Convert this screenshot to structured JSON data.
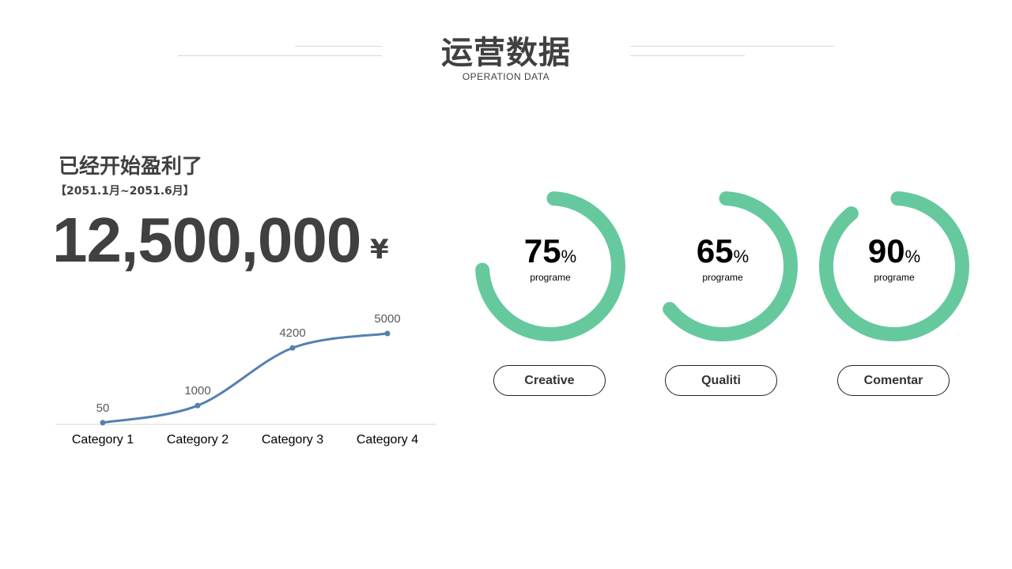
{
  "header": {
    "title": "运营数据",
    "subtitle": "OPERATION DATA"
  },
  "summary": {
    "headline": "已经开始盈利了",
    "period": "【2051.1月~2051.6月】",
    "amount": "12,500,000",
    "currency": "¥"
  },
  "chart_data": [
    {
      "type": "line",
      "categories": [
        "Category 1",
        "Category 2",
        "Category 3",
        "Category 4"
      ],
      "series": [
        {
          "values": [
            50,
            1000,
            4200,
            5000
          ]
        }
      ],
      "data_labels": [
        "50",
        "1000",
        "4200",
        "5000"
      ],
      "ylim": [
        0,
        5000
      ],
      "grid": false,
      "color": "#5580b0"
    },
    {
      "type": "pie",
      "style": "ring",
      "value_percent": 75,
      "value_text": "75",
      "unit": "%",
      "caption": "programe",
      "color": "#66c99e"
    },
    {
      "type": "pie",
      "style": "ring",
      "value_percent": 65,
      "value_text": "65",
      "unit": "%",
      "caption": "programe",
      "color": "#66c99e"
    },
    {
      "type": "pie",
      "style": "ring",
      "value_percent": 90,
      "value_text": "90",
      "unit": "%",
      "caption": "programe",
      "color": "#66c99e"
    }
  ],
  "buttons": [
    {
      "label": "Creative"
    },
    {
      "label": "Qualiti"
    },
    {
      "label": "Comentar"
    }
  ]
}
